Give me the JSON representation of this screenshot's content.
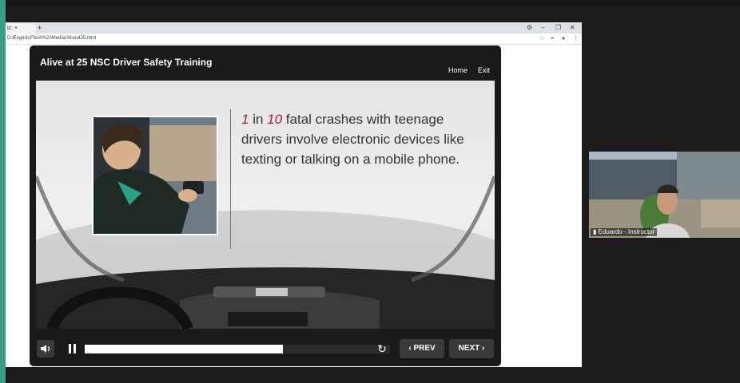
{
  "browser": {
    "tab_label": "ic: ",
    "tab_close": "×",
    "new_tab": "+",
    "url": "D:/English/Flash%20Media/Aliveat25.html",
    "window_controls": [
      "–",
      "❐",
      "✕"
    ]
  },
  "player": {
    "title": "Alive at 25 NSC Driver Safety Training",
    "nav": {
      "home": "Home",
      "exit": "Exit"
    },
    "slide": {
      "statement_num1": "1",
      "statement_text1": " in ",
      "statement_num2": "10",
      "statement_text2": " fatal crashes with teenage drivers involve electronic devices like texting or talking on a mobile phone.",
      "accent_color": "#c8102e"
    },
    "controls": {
      "mute_icon": "volume-icon",
      "pause_icon": "pause-icon",
      "progress": 0.65,
      "replay_icon": "replay-icon",
      "prev_label": "PREV",
      "next_label": "NEXT"
    }
  },
  "webcam": {
    "name": "Eduardo - Instructor"
  }
}
